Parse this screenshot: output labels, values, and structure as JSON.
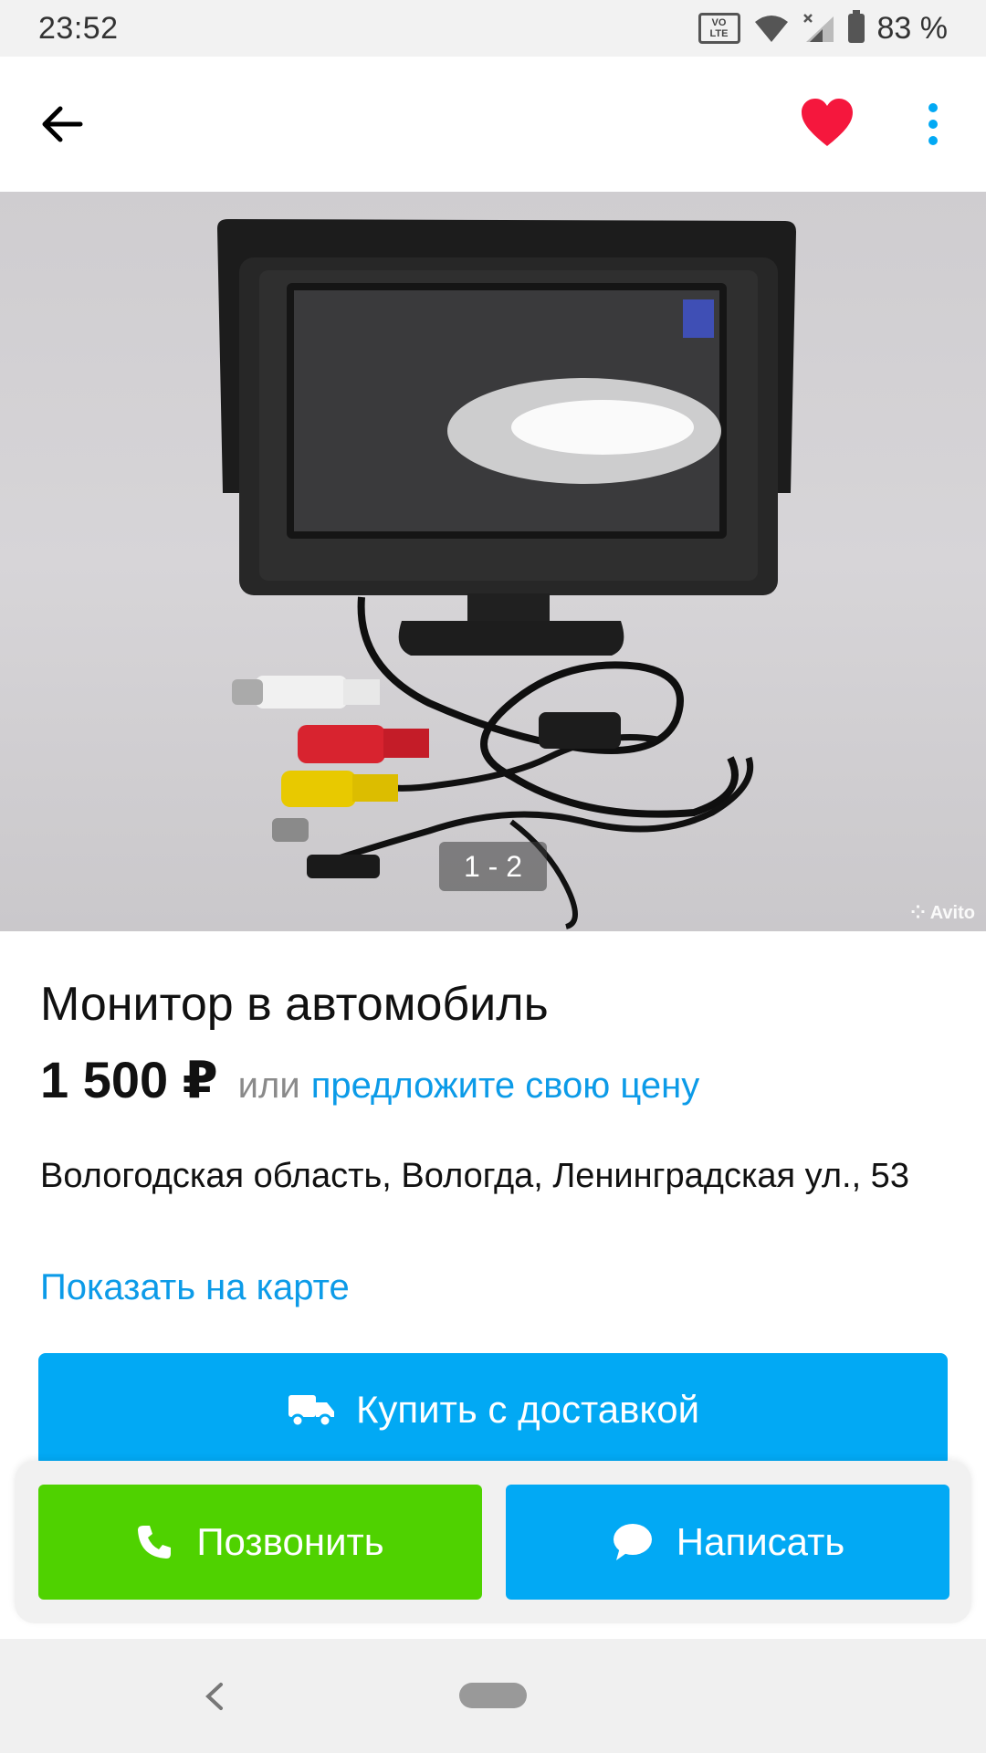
{
  "status_bar": {
    "time": "23:52",
    "network_badge_top": "VO",
    "network_badge_bottom": "LTE",
    "battery": "83 %",
    "icons": [
      "volte-icon",
      "wifi-icon",
      "signal-icon",
      "battery-icon"
    ]
  },
  "toolbar": {
    "back_icon": "arrow-left-icon",
    "favorite_icon": "heart-icon",
    "more_icon": "more-vertical-icon"
  },
  "gallery": {
    "counter": "1 - 2",
    "watermark": "Avito"
  },
  "listing": {
    "title": "Монитор в автомобиль",
    "price": "1 500 ₽",
    "or_text": "или",
    "offer_link": "предложите свою цену",
    "address": "Вологодская область, Вологда, Ленинградская ул., 53",
    "map_link": "Показать на карте"
  },
  "actions": {
    "buy_label": "Купить с доставкой",
    "call_label": "Позвонить",
    "write_label": "Написать"
  },
  "colors": {
    "accent_blue": "#02a9f4",
    "link_blue": "#0c9be8",
    "call_green": "#4fd200",
    "favorite_red": "#f5173d"
  }
}
